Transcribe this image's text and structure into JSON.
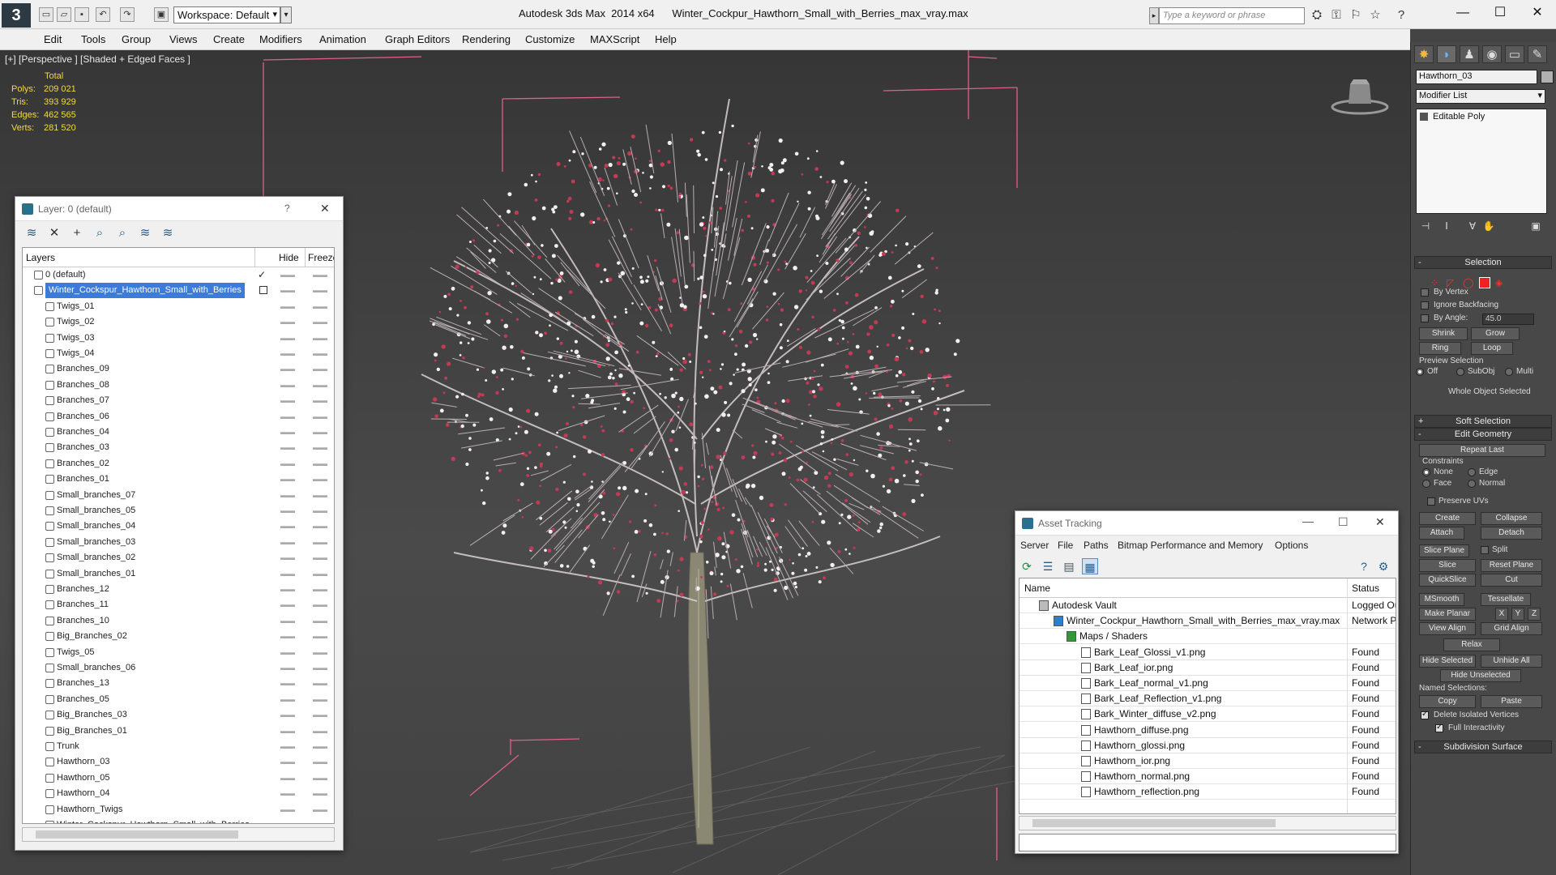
{
  "titlebar": {
    "workspace": "Workspace: Default",
    "app_name": "Autodesk 3ds Max  2014 x64",
    "file_name": "Winter_Cockpur_Hawthorn_Small_with_Berries_max_vray.max",
    "search_placeholder": "Type a keyword or phrase",
    "logo_icon": "3ds-max-logo-icon"
  },
  "menu": [
    "Edit",
    "Tools",
    "Group",
    "Views",
    "Create",
    "Modifiers",
    "Animation",
    "Graph Editors",
    "Rendering",
    "Customize",
    "MAXScript",
    "Help"
  ],
  "viewport": {
    "label": "[+] [Perspective ] [Shaded + Edged Faces ]",
    "stats_header": "Total",
    "stats": [
      {
        "label": "Polys:",
        "value": "209 021"
      },
      {
        "label": "Tris:",
        "value": "393 929"
      },
      {
        "label": "Edges:",
        "value": "462 565"
      },
      {
        "label": "Verts:",
        "value": "281 520"
      }
    ],
    "stats_color": "#f2d84a",
    "bbox_color": "#e0608a"
  },
  "layer_manager": {
    "title": "Layer: 0 (default)",
    "help": "?",
    "close": "✕",
    "col_layers": "Layers",
    "col_hide": "Hide",
    "col_freeze": "Freeze",
    "rows": [
      {
        "name": "0 (default)",
        "level": 0,
        "checked": true
      },
      {
        "name": "Winter_Cockspur_Hawthorn_Small_with_Berries",
        "level": 0,
        "selected": true
      },
      {
        "name": "Twigs_01",
        "level": 1
      },
      {
        "name": "Twigs_02",
        "level": 1
      },
      {
        "name": "Twigs_03",
        "level": 1
      },
      {
        "name": "Twigs_04",
        "level": 1
      },
      {
        "name": "Branches_09",
        "level": 1
      },
      {
        "name": "Branches_08",
        "level": 1
      },
      {
        "name": "Branches_07",
        "level": 1
      },
      {
        "name": "Branches_06",
        "level": 1
      },
      {
        "name": "Branches_04",
        "level": 1
      },
      {
        "name": "Branches_03",
        "level": 1
      },
      {
        "name": "Branches_02",
        "level": 1
      },
      {
        "name": "Branches_01",
        "level": 1
      },
      {
        "name": "Small_branches_07",
        "level": 1
      },
      {
        "name": "Small_branches_05",
        "level": 1
      },
      {
        "name": "Small_branches_04",
        "level": 1
      },
      {
        "name": "Small_branches_03",
        "level": 1
      },
      {
        "name": "Small_branches_02",
        "level": 1
      },
      {
        "name": "Small_branches_01",
        "level": 1
      },
      {
        "name": "Branches_12",
        "level": 1
      },
      {
        "name": "Branches_11",
        "level": 1
      },
      {
        "name": "Branches_10",
        "level": 1
      },
      {
        "name": "Big_Branches_02",
        "level": 1
      },
      {
        "name": "Twigs_05",
        "level": 1
      },
      {
        "name": "Small_branches_06",
        "level": 1
      },
      {
        "name": "Branches_13",
        "level": 1
      },
      {
        "name": "Branches_05",
        "level": 1
      },
      {
        "name": "Big_Branches_03",
        "level": 1
      },
      {
        "name": "Big_Branches_01",
        "level": 1
      },
      {
        "name": "Trunk",
        "level": 1
      },
      {
        "name": "Hawthorn_03",
        "level": 1
      },
      {
        "name": "Hawthorn_05",
        "level": 1
      },
      {
        "name": "Hawthorn_04",
        "level": 1
      },
      {
        "name": "Hawthorn_Twigs",
        "level": 1
      },
      {
        "name": "Winter_Cockspur_Hawthorn_Small_with_Berries",
        "level": 1
      }
    ]
  },
  "asset_tracking": {
    "title": "Asset Tracking",
    "menus": [
      "Server",
      "File",
      "Paths",
      "Bitmap Performance and Memory",
      "Options"
    ],
    "col_name": "Name",
    "col_status": "Status",
    "rows": [
      {
        "name": "Autodesk Vault",
        "status": "Logged Ou",
        "level": 0
      },
      {
        "name": "Winter_Cockpur_Hawthorn_Small_with_Berries_max_vray.max",
        "status": "Network P",
        "level": 1
      },
      {
        "name": "Maps / Shaders",
        "status": "",
        "level": 2
      },
      {
        "name": "Bark_Leaf_Glossi_v1.png",
        "status": "Found",
        "level": 3
      },
      {
        "name": "Bark_Leaf_ior.png",
        "status": "Found",
        "level": 3
      },
      {
        "name": "Bark_Leaf_normal_v1.png",
        "status": "Found",
        "level": 3
      },
      {
        "name": "Bark_Leaf_Reflection_v1.png",
        "status": "Found",
        "level": 3
      },
      {
        "name": "Bark_Winter_diffuse_v2.png",
        "status": "Found",
        "level": 3
      },
      {
        "name": "Hawthorn_diffuse.png",
        "status": "Found",
        "level": 3
      },
      {
        "name": "Hawthorn_glossi.png",
        "status": "Found",
        "level": 3
      },
      {
        "name": "Hawthorn_ior.png",
        "status": "Found",
        "level": 3
      },
      {
        "name": "Hawthorn_normal.png",
        "status": "Found",
        "level": 3
      },
      {
        "name": "Hawthorn_reflection.png",
        "status": "Found",
        "level": 3
      }
    ]
  },
  "command_panel": {
    "object_name": "Hawthorn_03",
    "modifier_list": "Modifier List",
    "stack_entry": "Editable Poly",
    "selection": {
      "title": "Selection",
      "by_vertex": "By Vertex",
      "ignore_backfacing": "Ignore Backfacing",
      "by_angle": "By Angle:",
      "angle_value": "45.0",
      "shrink": "Shrink",
      "grow": "Grow",
      "ring": "Ring",
      "loop": "Loop",
      "preview_selection": "Preview Selection",
      "off": "Off",
      "subobj": "SubObj",
      "multi": "Multi",
      "whole_object": "Whole Object Selected"
    },
    "soft_selection": "Soft Selection",
    "edit_geometry": {
      "title": "Edit Geometry",
      "repeat_last": "Repeat Last",
      "constraints": "Constraints",
      "none": "None",
      "edge": "Edge",
      "face": "Face",
      "normal": "Normal",
      "preserve_uvs": "Preserve UVs",
      "create": "Create",
      "collapse": "Collapse",
      "attach": "Attach",
      "detach": "Detach",
      "slice_plane": "Slice Plane",
      "split": "Split",
      "slice": "Slice",
      "reset_plane": "Reset Plane",
      "quickslice": "QuickSlice",
      "cut": "Cut",
      "msmooth": "MSmooth",
      "tessellate": "Tessellate",
      "make_planar": "Make Planar",
      "x": "X",
      "y": "Y",
      "z": "Z",
      "view_align": "View Align",
      "grid_align": "Grid Align",
      "relax": "Relax",
      "hide_selected": "Hide Selected",
      "unhide_all": "Unhide All",
      "hide_unselected": "Hide Unselected",
      "named_selections": "Named Selections:",
      "copy": "Copy",
      "paste": "Paste",
      "delete_isolated": "Delete Isolated Vertices",
      "full_interactivity": "Full Interactivity"
    },
    "subdivision_surface": "Subdivision Surface"
  }
}
